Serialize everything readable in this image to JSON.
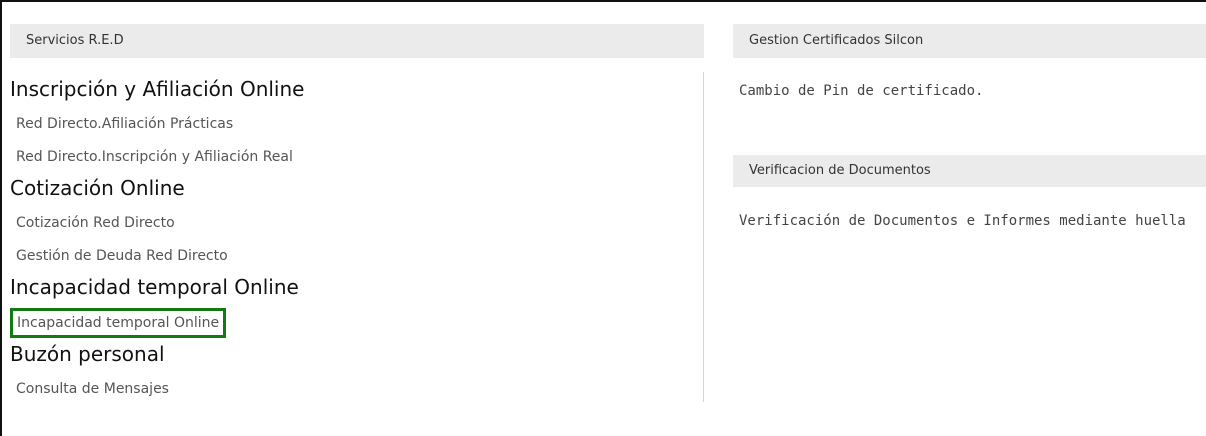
{
  "left_panel": {
    "header": "Servicios R.E.D",
    "sections": [
      {
        "title": "Inscripción y Afiliación Online",
        "links": [
          "Red Directo.Afiliación Prácticas",
          "Red Directo.Inscripción y Afiliación Real"
        ]
      },
      {
        "title": "Cotización Online",
        "links": [
          "Cotización Red Directo",
          "Gestión de Deuda Red Directo"
        ]
      },
      {
        "title": "Incapacidad temporal Online",
        "links": [
          "Incapacidad temporal Online"
        ]
      },
      {
        "title": "Buzón personal",
        "links": [
          "Consulta de Mensajes"
        ]
      }
    ]
  },
  "right_panel": {
    "certificados": {
      "header": "Gestion Certificados Silcon",
      "link": "Cambio de Pin de certificado."
    },
    "verificacion": {
      "header": "Verificacion de Documentos",
      "link": "Verificación de Documentos e Informes mediante huella"
    }
  },
  "highlight": {
    "color": "#127a12",
    "target": "Incapacidad temporal Online"
  }
}
